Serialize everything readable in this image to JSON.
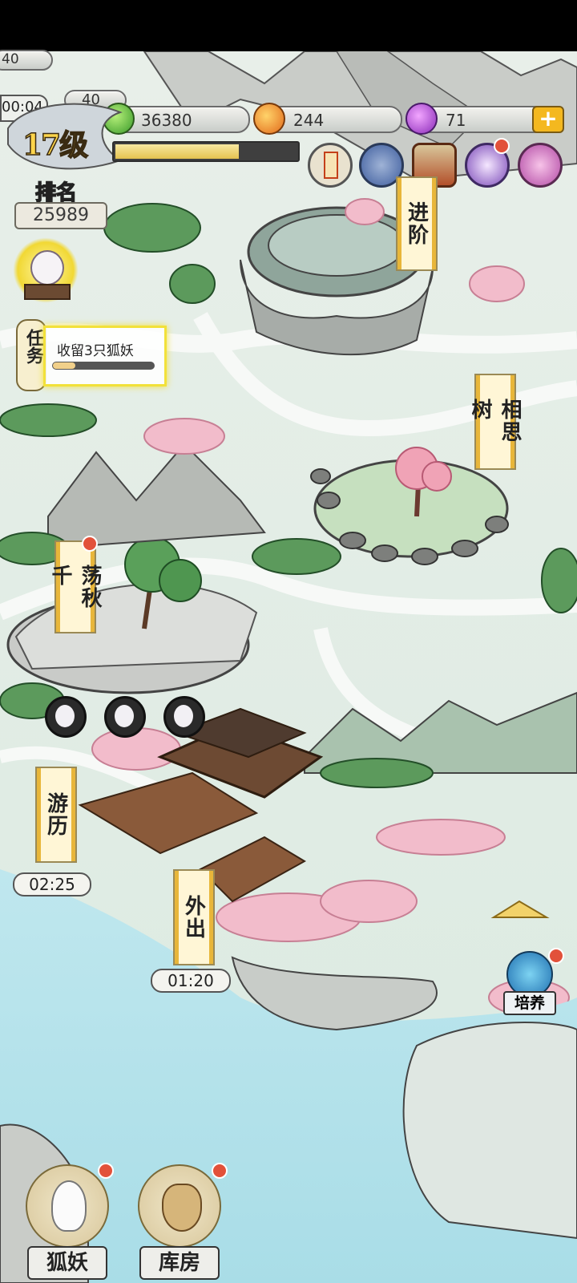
{
  "colors": {
    "water": "#bfe6ec",
    "land": "#dfece4",
    "accent_gold": "#f4b81f",
    "red_dot": "#e2513a",
    "blossom": "#f0b9c8"
  },
  "partial_top": {
    "left_value": "40",
    "left_timer": "00:04",
    "second_value": "40"
  },
  "currencies": [
    {
      "icon": "green-jade-icon",
      "value": "36380"
    },
    {
      "icon": "fire-coin-icon",
      "value": "244"
    },
    {
      "icon": "purple-gem-icon",
      "value": "71"
    }
  ],
  "add_label": "+",
  "player": {
    "level": "17级",
    "xp_progress": 0.68,
    "rank_label": "排名",
    "rank_value": "25989"
  },
  "top_icons": [
    "talisman-scroll-icon",
    "compass-icon",
    "chest-icon",
    "gacha-orb-icon",
    "bag-icon"
  ],
  "quest": {
    "tab_label": "任务",
    "text": "收留3只狐妖",
    "progress": 0.22
  },
  "locations": [
    {
      "id": "advance",
      "label": "进阶"
    },
    {
      "id": "lovetree",
      "label": "相思树"
    },
    {
      "id": "swing",
      "label": "荡秋千"
    },
    {
      "id": "travel",
      "label": "游历",
      "timer": "02:25"
    },
    {
      "id": "outing",
      "label": "外出",
      "timer": "01:20"
    }
  ],
  "cultivate": {
    "label": "培养"
  },
  "bottom": {
    "foxes": "狐妖",
    "storage": "库房"
  }
}
